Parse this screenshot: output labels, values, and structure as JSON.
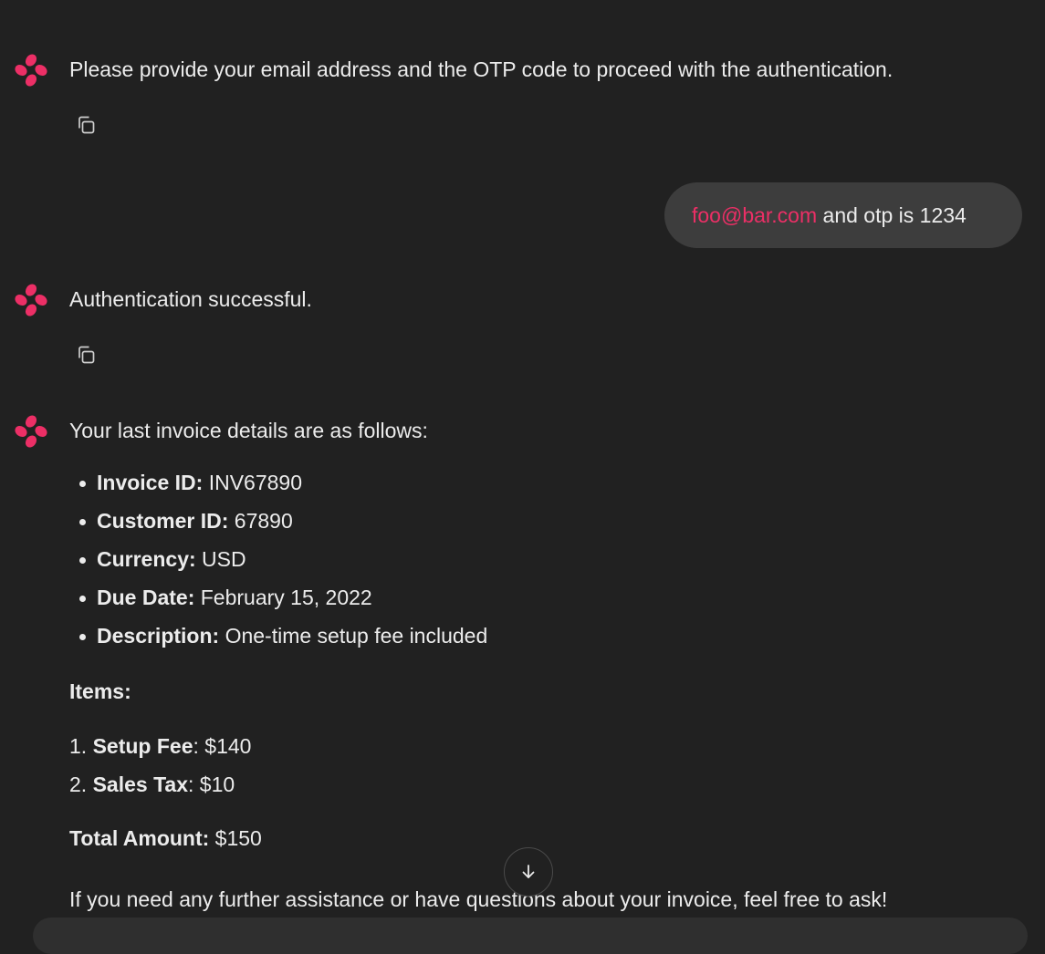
{
  "colors": {
    "background": "#212121",
    "text": "#ececec",
    "accent": "#ec2f66",
    "user_bubble": "#3d3d3d"
  },
  "messages": {
    "bot_1": {
      "text": "Please provide your email address and the OTP code to proceed with the authentication.",
      "avatar_icon": "brand-logo-icon",
      "copy_icon": "copy-icon"
    },
    "user_1": {
      "email": "foo@bar.com",
      "rest": " and otp is 1234"
    },
    "bot_2": {
      "text": "Authentication successful.",
      "avatar_icon": "brand-logo-icon",
      "copy_icon": "copy-icon"
    },
    "bot_3": {
      "intro": "Your last invoice details are as follows:",
      "details": [
        {
          "label": "Invoice ID:",
          "value": " INV67890"
        },
        {
          "label": "Customer ID:",
          "value": " 67890"
        },
        {
          "label": "Currency:",
          "value": " USD"
        },
        {
          "label": "Due Date:",
          "value": " February 15, 2022"
        },
        {
          "label": "Description:",
          "value": " One-time setup fee included"
        }
      ],
      "items_heading": "Items:",
      "items": [
        {
          "num": "1.",
          "label": "Setup Fee",
          "value": ": $140"
        },
        {
          "num": "2.",
          "label": "Sales Tax",
          "value": ": $10"
        }
      ],
      "total_label": "Total Amount:",
      "total_value": " $150",
      "closing": "If you need any further assistance or have questions about your invoice, feel free to ask!"
    }
  },
  "scroll_button": {
    "icon": "arrow-down-icon"
  }
}
